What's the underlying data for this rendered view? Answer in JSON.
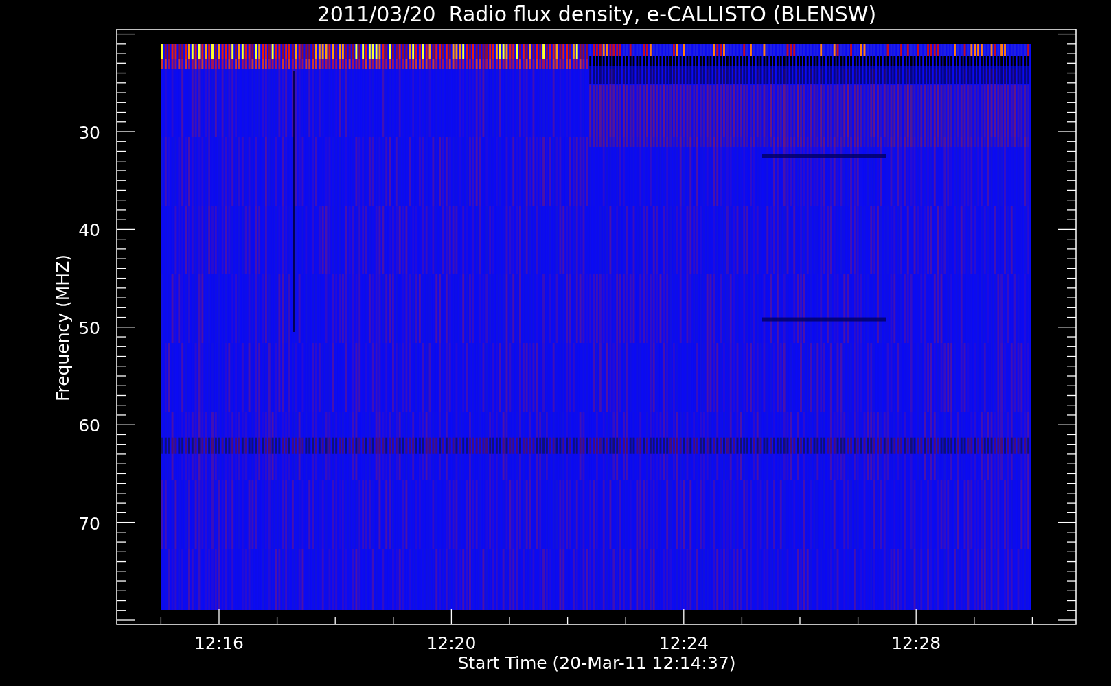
{
  "title": "2011/03/20  Radio flux density, e-CALLISTO (BLENSW)",
  "ylabel": "Frequency (MHZ)",
  "xlabel": "Start Time (20-Mar-11 12:14:37)",
  "yticks": [
    "30",
    "40",
    "50",
    "60",
    "70"
  ],
  "xticks": [
    "12:16",
    "12:20",
    "12:24",
    "12:28"
  ]
}
